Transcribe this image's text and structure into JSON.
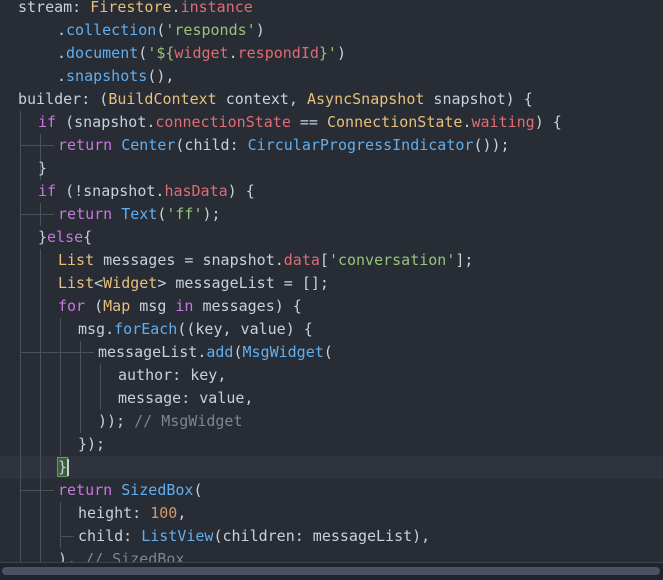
{
  "editor": {
    "colors": {
      "background": "#282c34",
      "active_line": "#2f333d",
      "keyword": "#c678dd",
      "property": "#e06c75",
      "function": "#61afef",
      "type": "#e5c07b",
      "string": "#98c379",
      "number": "#d19a66",
      "comment": "#7f848e",
      "plain": "#cbd0d8"
    },
    "lines": [
      {
        "tokens": [
          [
            "plain",
            "stream: "
          ],
          [
            "type",
            "Firestore"
          ],
          [
            "plain",
            "."
          ],
          [
            "property",
            "instance"
          ]
        ]
      },
      {
        "tokens": [
          [
            "plain",
            "."
          ],
          [
            "function",
            "collection"
          ],
          [
            "plain",
            "("
          ],
          [
            "string",
            "'responds'"
          ],
          [
            "plain",
            ")"
          ]
        ]
      },
      {
        "tokens": [
          [
            "plain",
            "."
          ],
          [
            "function",
            "document"
          ],
          [
            "plain",
            "("
          ],
          [
            "string",
            "'${"
          ],
          [
            "property",
            "widget"
          ],
          [
            "plain",
            "."
          ],
          [
            "property",
            "respondId"
          ],
          [
            "string",
            "}'"
          ],
          [
            "plain",
            ")"
          ]
        ]
      },
      {
        "tokens": [
          [
            "plain",
            "."
          ],
          [
            "function",
            "snapshots"
          ],
          [
            "plain",
            "(),"
          ]
        ]
      },
      {
        "tokens": [
          [
            "plain",
            "builder: ("
          ],
          [
            "type",
            "BuildContext"
          ],
          [
            "plain",
            " context, "
          ],
          [
            "type",
            "AsyncSnapshot"
          ],
          [
            "plain",
            " snapshot) {"
          ]
        ]
      },
      {
        "tokens": [
          [
            "keyword",
            "if"
          ],
          [
            "plain",
            " (snapshot."
          ],
          [
            "property",
            "connectionState"
          ],
          [
            "plain",
            " == "
          ],
          [
            "type",
            "ConnectionState"
          ],
          [
            "plain",
            "."
          ],
          [
            "property",
            "waiting"
          ],
          [
            "plain",
            ") {"
          ]
        ]
      },
      {
        "tokens": [
          [
            "keyword",
            "return"
          ],
          [
            "plain",
            " "
          ],
          [
            "function",
            "Center"
          ],
          [
            "plain",
            "(child: "
          ],
          [
            "function",
            "CircularProgressIndicator"
          ],
          [
            "plain",
            "());"
          ]
        ]
      },
      {
        "tokens": [
          [
            "plain",
            "}"
          ]
        ]
      },
      {
        "tokens": [
          [
            "keyword",
            "if"
          ],
          [
            "plain",
            " (!snapshot."
          ],
          [
            "property",
            "hasData"
          ],
          [
            "plain",
            ") {"
          ]
        ]
      },
      {
        "tokens": [
          [
            "keyword",
            "return"
          ],
          [
            "plain",
            " "
          ],
          [
            "function",
            "Text"
          ],
          [
            "plain",
            "("
          ],
          [
            "string",
            "'ff'"
          ],
          [
            "plain",
            ");"
          ]
        ]
      },
      {
        "tokens": [
          [
            "plain",
            "}"
          ],
          [
            "keyword",
            "else"
          ],
          [
            "plain",
            "{"
          ]
        ]
      },
      {
        "tokens": [
          [
            "type",
            "List"
          ],
          [
            "plain",
            " messages = snapshot."
          ],
          [
            "property",
            "data"
          ],
          [
            "plain",
            "["
          ],
          [
            "string",
            "'conversation'"
          ],
          [
            "plain",
            "];"
          ]
        ]
      },
      {
        "tokens": [
          [
            "type",
            "List"
          ],
          [
            "plain",
            "<"
          ],
          [
            "type",
            "Widget"
          ],
          [
            "plain",
            "> messageList = [];"
          ]
        ]
      },
      {
        "tokens": [
          [
            "keyword",
            "for"
          ],
          [
            "plain",
            " ("
          ],
          [
            "type",
            "Map"
          ],
          [
            "plain",
            " msg "
          ],
          [
            "keyword",
            "in"
          ],
          [
            "plain",
            " messages) {"
          ]
        ]
      },
      {
        "tokens": [
          [
            "plain",
            "msg."
          ],
          [
            "function",
            "forEach"
          ],
          [
            "plain",
            "((key, value) {"
          ]
        ]
      },
      {
        "tokens": [
          [
            "plain",
            "messageList."
          ],
          [
            "function",
            "add"
          ],
          [
            "plain",
            "("
          ],
          [
            "function",
            "MsgWidget"
          ],
          [
            "plain",
            "("
          ]
        ]
      },
      {
        "tokens": [
          [
            "plain",
            "author: key,"
          ]
        ]
      },
      {
        "tokens": [
          [
            "plain",
            "message: value,"
          ]
        ]
      },
      {
        "tokens": [
          [
            "plain",
            "));"
          ],
          [
            "comment",
            " // MsgWidget"
          ]
        ]
      },
      {
        "tokens": [
          [
            "plain",
            "});"
          ]
        ]
      },
      {
        "tokens": [
          [
            "plain",
            "}"
          ]
        ]
      },
      {
        "tokens": [
          [
            "keyword",
            "return"
          ],
          [
            "plain",
            " "
          ],
          [
            "function",
            "SizedBox"
          ],
          [
            "plain",
            "("
          ]
        ]
      },
      {
        "tokens": [
          [
            "plain",
            "height: "
          ],
          [
            "number",
            "100"
          ],
          [
            "plain",
            ","
          ]
        ]
      },
      {
        "tokens": [
          [
            "plain",
            "child: "
          ],
          [
            "function",
            "ListView"
          ],
          [
            "plain",
            "(children: messageList),"
          ]
        ]
      },
      {
        "tokens": [
          [
            "plain",
            "), "
          ],
          [
            "comment",
            "// SizedBox"
          ]
        ]
      }
    ]
  }
}
